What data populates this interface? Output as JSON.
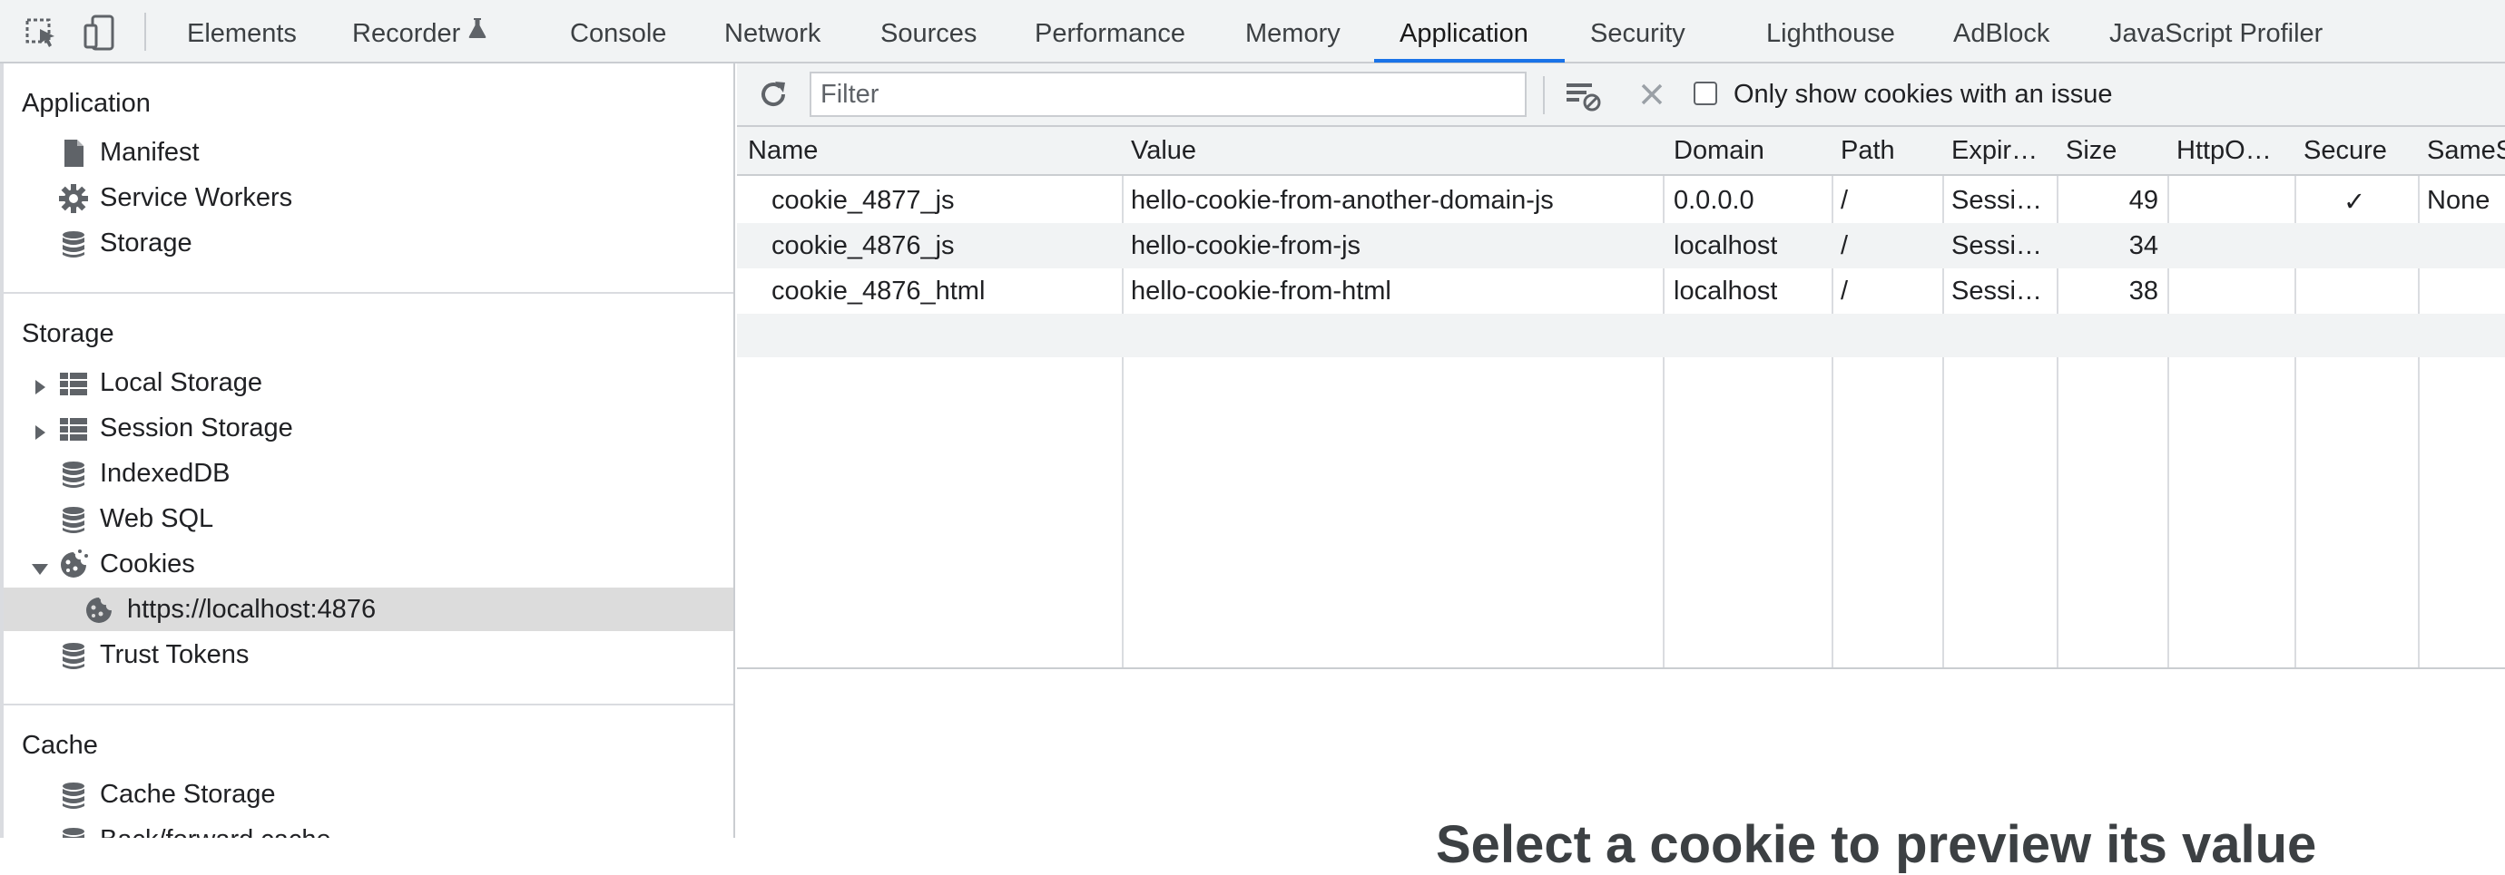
{
  "toolbar_tabs": {
    "elements": "Elements",
    "recorder": "Recorder",
    "console": "Console",
    "network": "Network",
    "sources": "Sources",
    "performance": "Performance",
    "memory": "Memory",
    "application": "Application",
    "security": "Security",
    "lighthouse": "Lighthouse",
    "adblock": "AdBlock",
    "js_profiler": "JavaScript Profiler",
    "active": "Application"
  },
  "sidebar": {
    "application_section": {
      "title": "Application",
      "items": [
        "Manifest",
        "Service Workers",
        "Storage"
      ]
    },
    "storage_section": {
      "title": "Storage",
      "items": [
        "Local Storage",
        "Session Storage",
        "IndexedDB",
        "Web SQL",
        "Cookies",
        "https://localhost:4876",
        "Trust Tokens"
      ]
    },
    "cache_section": {
      "title": "Cache",
      "items": [
        "Cache Storage",
        "Back/forward cache"
      ]
    },
    "selected": "https://localhost:4876"
  },
  "cookies_toolbar": {
    "filter_placeholder": "Filter",
    "filter_value": "",
    "only_issues_label": "Only show cookies with an issue",
    "only_issues_checked": false
  },
  "table": {
    "headers": [
      "Name",
      "Value",
      "Domain",
      "Path",
      "Expir…",
      "Size",
      "HttpO…",
      "Secure",
      "SameS"
    ],
    "rows": [
      [
        "cookie_4877_js",
        "hello-cookie-from-another-domain-js",
        "0.0.0.0",
        "/",
        "Sessi…",
        "49",
        "",
        "✓",
        "None"
      ],
      [
        "cookie_4876_js",
        "hello-cookie-from-js",
        "localhost",
        "/",
        "Sessi…",
        "34",
        "",
        "",
        ""
      ],
      [
        "cookie_4876_html",
        "hello-cookie-from-html",
        "localhost",
        "/",
        "Sessi…",
        "38",
        "",
        "",
        ""
      ]
    ]
  },
  "preview": {
    "text": "Select a cookie to preview its value"
  },
  "colors": {
    "accent": "#1a73e8",
    "toolbar_bg": "#f1f3f4",
    "selected_row": "#dcdcdc",
    "border": "#cacdd1"
  }
}
